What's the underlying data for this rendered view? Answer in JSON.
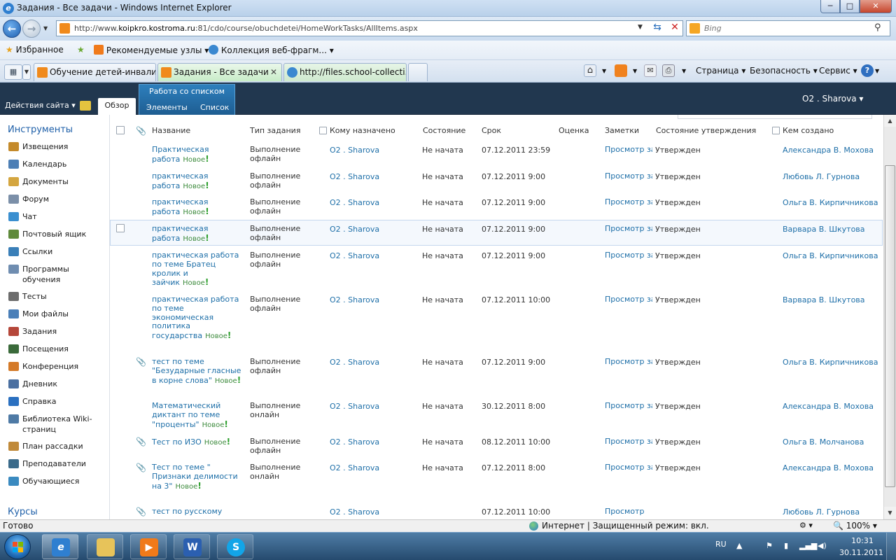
{
  "window": {
    "title": "Задания - Все задачи - Windows Internet Explorer",
    "min": "─",
    "max": "□",
    "close": "✕"
  },
  "address": {
    "url_prefix": "http://www.",
    "url_host": "koipkro.kostroma.ru",
    "url_rest": ":81/cdo/course/obuchdetei/HomeWorkTasks/AllItems.aspx",
    "search_placeholder": "Bing"
  },
  "favorites": {
    "favorites_label": "Избранное",
    "suggested_label": "Рекомендуемые узлы",
    "gallery_label": "Коллекция веб-фрагм..."
  },
  "tabs": [
    {
      "label": "Обучение детей-инвалид..."
    },
    {
      "label": "Задания - Все задачи"
    },
    {
      "label": "http://files.school-collecti..."
    }
  ],
  "commandbar": {
    "page": "Страница",
    "safety": "Безопасность",
    "service": "Сервис"
  },
  "ribbon": {
    "site_actions": "Действия сайта",
    "browse_tab": "Обзор",
    "context_group": "Работа со списком",
    "items_tab": "Элементы",
    "list_tab": "Список",
    "user": "O2 . Sharova"
  },
  "leftnav": {
    "heading": "Инструменты",
    "items": [
      {
        "label": "Извещения",
        "color": "#c48a2a"
      },
      {
        "label": "Календарь",
        "color": "#4d7fb5"
      },
      {
        "label": "Документы",
        "color": "#d4a640"
      },
      {
        "label": "Форум",
        "color": "#7b8fa8"
      },
      {
        "label": "Чат",
        "color": "#3a8fd0"
      },
      {
        "label": "Почтовый ящик",
        "color": "#5f8a3b"
      },
      {
        "label": "Ссылки",
        "color": "#3a7fb8"
      },
      {
        "label": "Программы обучения",
        "color": "#6f8db0"
      },
      {
        "label": "Тесты",
        "color": "#6c6c6c"
      },
      {
        "label": "Мои файлы",
        "color": "#4a7fb8"
      },
      {
        "label": "Задания",
        "color": "#b5473a"
      },
      {
        "label": "Посещения",
        "color": "#3a6a3a"
      },
      {
        "label": "Конференция",
        "color": "#d47a28"
      },
      {
        "label": "Дневник",
        "color": "#4a6fa0"
      },
      {
        "label": "Справка",
        "color": "#2a70c0"
      },
      {
        "label": "Библиотека Wiki-страниц",
        "color": "#4e7aa5"
      },
      {
        "label": "План рассадки",
        "color": "#c08a3a"
      },
      {
        "label": "Преподаватели",
        "color": "#3a6a8a"
      },
      {
        "label": "Обучающиеся",
        "color": "#3a8ac0"
      }
    ],
    "heading2": "Курсы"
  },
  "table": {
    "headers": {
      "title": "Название",
      "type": "Тип задания",
      "assigned": "Кому назначено",
      "state": "Состояние",
      "due": "Срок",
      "grade": "Оценка",
      "notes": "Заметки",
      "approval": "Состояние утверждения",
      "created_by": "Кем создано"
    },
    "new_label": "Новое",
    "rows": [
      {
        "title": "Практическая работа",
        "type": "Выполнение офлайн",
        "assigned": "O2 . Sharova",
        "state": "Не начата",
        "due": "07.12.2011 23:59",
        "notes": "Просмотр записей...",
        "approval": "Утвержден",
        "created_by": "Александра В. Мохова",
        "attachment": false
      },
      {
        "title": "практическая работа",
        "type": "Выполнение офлайн",
        "assigned": "O2 . Sharova",
        "state": "Не начата",
        "due": "07.12.2011 9:00",
        "notes": "Просмотр записей...",
        "approval": "Утвержден",
        "created_by": "Любовь Л. Гурнова",
        "attachment": false
      },
      {
        "title": "практическая работа",
        "type": "Выполнение офлайн",
        "assigned": "O2 . Sharova",
        "state": "Не начата",
        "due": "07.12.2011 9:00",
        "notes": "Просмотр записей...",
        "approval": "Утвержден",
        "created_by": "Ольга В. Кирпичникова",
        "attachment": false
      },
      {
        "title": "практическая работа",
        "type": "Выполнение офлайн",
        "assigned": "O2 . Sharova",
        "state": "Не начата",
        "due": "07.12.2011 9:00",
        "notes": "Просмотр записей...",
        "approval": "Утвержден",
        "created_by": "Варвара В. Шкутова",
        "attachment": false,
        "selected": true
      },
      {
        "title": "практическая работа по теме Братец кролик и зайчик",
        "type": "Выполнение офлайн",
        "assigned": "O2 . Sharova",
        "state": "Не начата",
        "due": "07.12.2011 9:00",
        "notes": "Просмотр записей...",
        "approval": "Утвержден",
        "created_by": "Ольга В. Кирпичникова",
        "attachment": false
      },
      {
        "title": "практическая работа по теме экономическая политика государства",
        "type": "Выполнение офлайн",
        "assigned": "O2 . Sharova",
        "state": "Не начата",
        "due": "07.12.2011 10:00",
        "notes": "Просмотр записей...",
        "approval": "Утвержден",
        "created_by": "Варвара В. Шкутова",
        "attachment": false
      },
      {
        "title": "тест по теме \"Безударные гласные в корне слова\"",
        "type": "Выполнение офлайн",
        "assigned": "O2 . Sharova",
        "state": "Не начата",
        "due": "07.12.2011 9:00",
        "notes": "Просмотр записей...",
        "approval": "Утвержден",
        "created_by": "Ольга В. Кирпичникова",
        "attachment": true
      },
      {
        "title": "Математический диктант по теме \"проценты\"",
        "type": "Выполнение онлайн",
        "assigned": "O2 . Sharova",
        "state": "Не начата",
        "due": "30.12.2011 8:00",
        "notes": "Просмотр записей...",
        "approval": "Утвержден",
        "created_by": "Александра В. Мохова",
        "attachment": false
      },
      {
        "title": "Тест по ИЗО",
        "type": "Выполнение офлайн",
        "assigned": "O2 . Sharova",
        "state": "Не начата",
        "due": "08.12.2011 10:00",
        "notes": "Просмотр записей...",
        "approval": "Утвержден",
        "created_by": "Ольга В. Молчанова",
        "attachment": true
      },
      {
        "title": "Тест по теме \" Признаки делимости на 3\"",
        "type": "Выполнение онлайн",
        "assigned": "O2 . Sharova",
        "state": "Не начата",
        "due": "07.12.2011 8:00",
        "notes": "Просмотр записей...",
        "approval": "Утвержден",
        "created_by": "Александра В. Мохова",
        "attachment": true
      },
      {
        "title": "тест по русскому",
        "type": "",
        "assigned": "O2 . Sharova",
        "state": "",
        "due": "07.12.2011 10:00",
        "notes": "Просмотр",
        "approval": "",
        "created_by": "Любовь Л. Гурнова",
        "attachment": true
      }
    ]
  },
  "statusbar": {
    "status": "Готово",
    "zone": "Интернет | Защищенный режим: вкл.",
    "zoom": "100%"
  },
  "taskbar": {
    "lang": "RU",
    "time": "10:31",
    "date": "30.11.2011"
  }
}
